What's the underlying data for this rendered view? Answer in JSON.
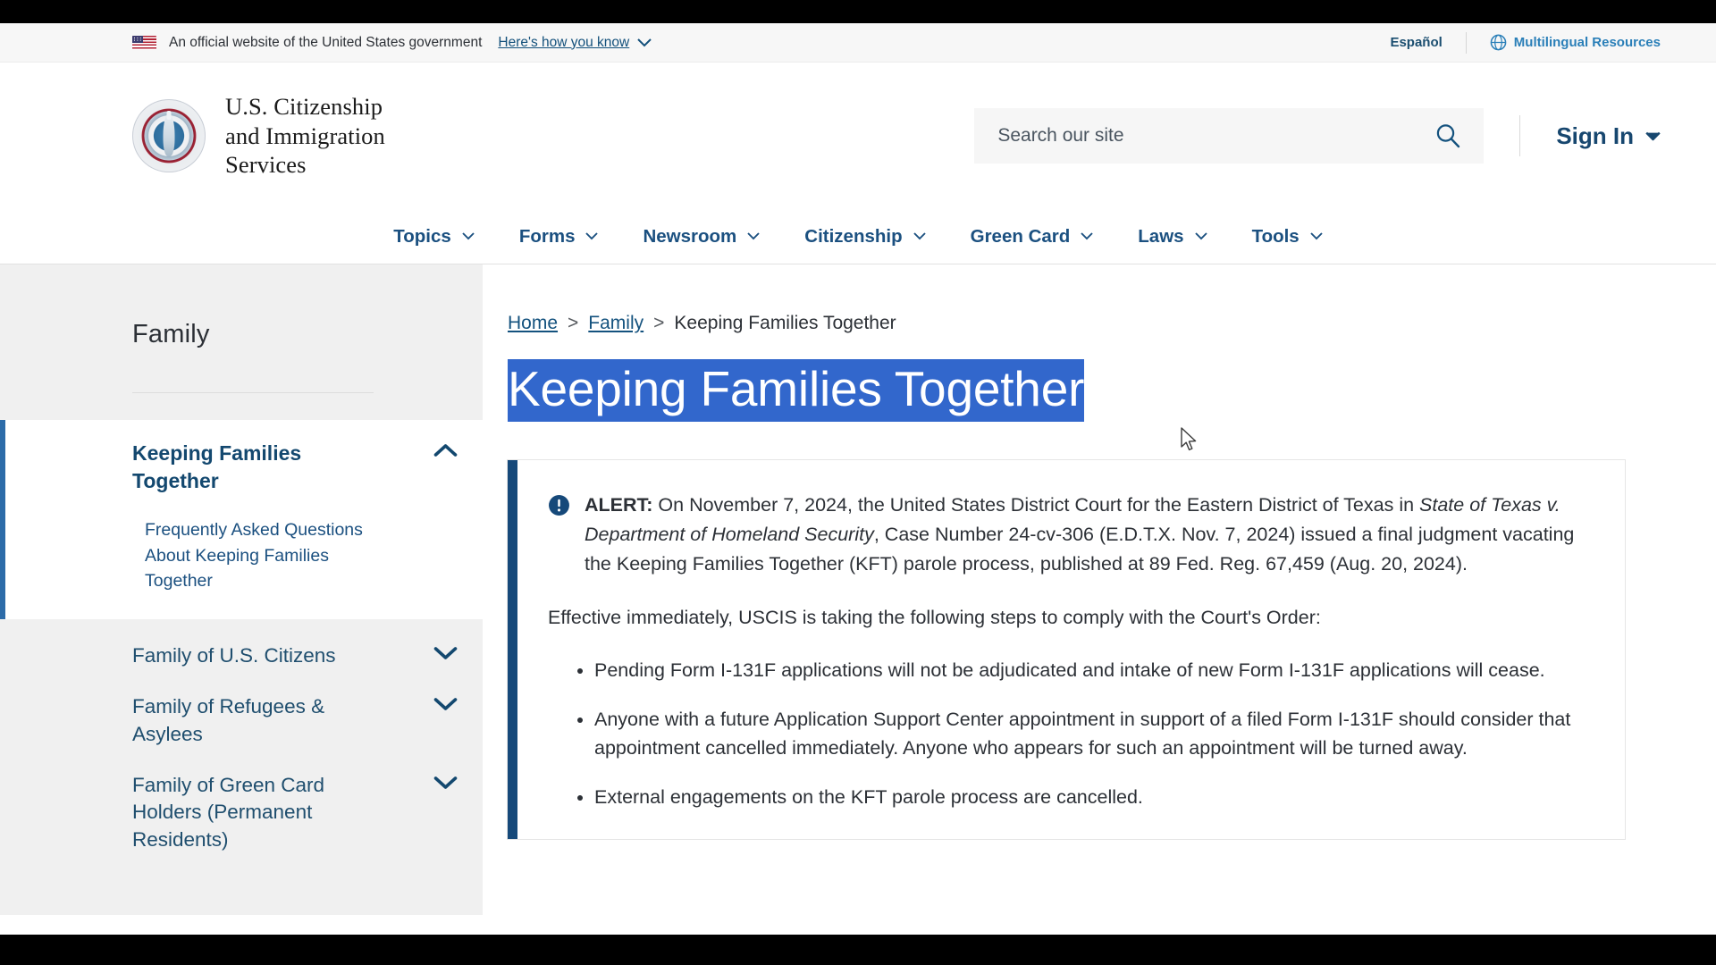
{
  "gov_banner": {
    "flag_icon": "us-flag-icon",
    "text": "An official website of the United States government",
    "how_you_know": "Here's how you know",
    "chevron_icon": "chevron-down-icon",
    "espanol": "Español",
    "globe_icon": "globe-icon",
    "multilingual": "Multilingual Resources"
  },
  "header": {
    "seal_icon": "uscis-seal-icon",
    "logo_line1": "U.S. Citizenship",
    "logo_line2": "and Immigration",
    "logo_line3": "Services",
    "search_placeholder": "Search our site",
    "search_value": "",
    "search_icon": "search-icon",
    "signin_label": "Sign In",
    "signin_chevron": "chevron-down-icon"
  },
  "nav": {
    "items": [
      {
        "label": "Topics"
      },
      {
        "label": "Forms"
      },
      {
        "label": "Newsroom"
      },
      {
        "label": "Citizenship"
      },
      {
        "label": "Green Card"
      },
      {
        "label": "Laws"
      },
      {
        "label": "Tools"
      }
    ]
  },
  "sidebar": {
    "heading": "Family",
    "active": {
      "label": "Keeping Families Together",
      "chevron_icon": "chevron-up-icon",
      "sub_label": "Frequently Asked Questions About Keeping Families Together"
    },
    "items": [
      {
        "label": "Family of U.S. Citizens",
        "chevron_icon": "chevron-down-icon"
      },
      {
        "label": "Family of Refugees & Asylees",
        "chevron_icon": "chevron-down-icon"
      },
      {
        "label": "Family of Green Card Holders (Permanent Residents)",
        "chevron_icon": "chevron-down-icon"
      }
    ]
  },
  "breadcrumb": {
    "home": "Home",
    "sep1": ">",
    "family": "Family",
    "sep2": ">",
    "current": "Keeping Families Together"
  },
  "page": {
    "title": "Keeping Families Together",
    "title_selected": true,
    "selection_color": "#3267cc"
  },
  "alert": {
    "icon": "info-circle-icon",
    "accent_color": "#16497a",
    "label": "ALERT:",
    "para1_a": " On November 7, 2024, the United States District Court for the Eastern District of Texas in ",
    "para1_italic": "State of Texas v. Department of Homeland Security",
    "para1_b": ", Case Number 24-cv-306 (E.D.T.X. Nov. 7, 2024) issued a final judgment vacating the Keeping Families Together (KFT) parole process, published at 89 Fed. Reg. 67,459 (Aug. 20, 2024).",
    "para2": "Effective immediately, USCIS is taking the following steps to comply with the Court's Order:",
    "bullets": [
      "Pending Form I-131F applications will not be adjudicated and intake of new Form I-131F applications will cease.",
      "Anyone with a future Application Support Center appointment in support of a filed Form I-131F should consider that appointment cancelled immediately. Anyone who appears for such an appointment will be turned away.",
      "External engagements on the KFT parole process are cancelled."
    ]
  }
}
